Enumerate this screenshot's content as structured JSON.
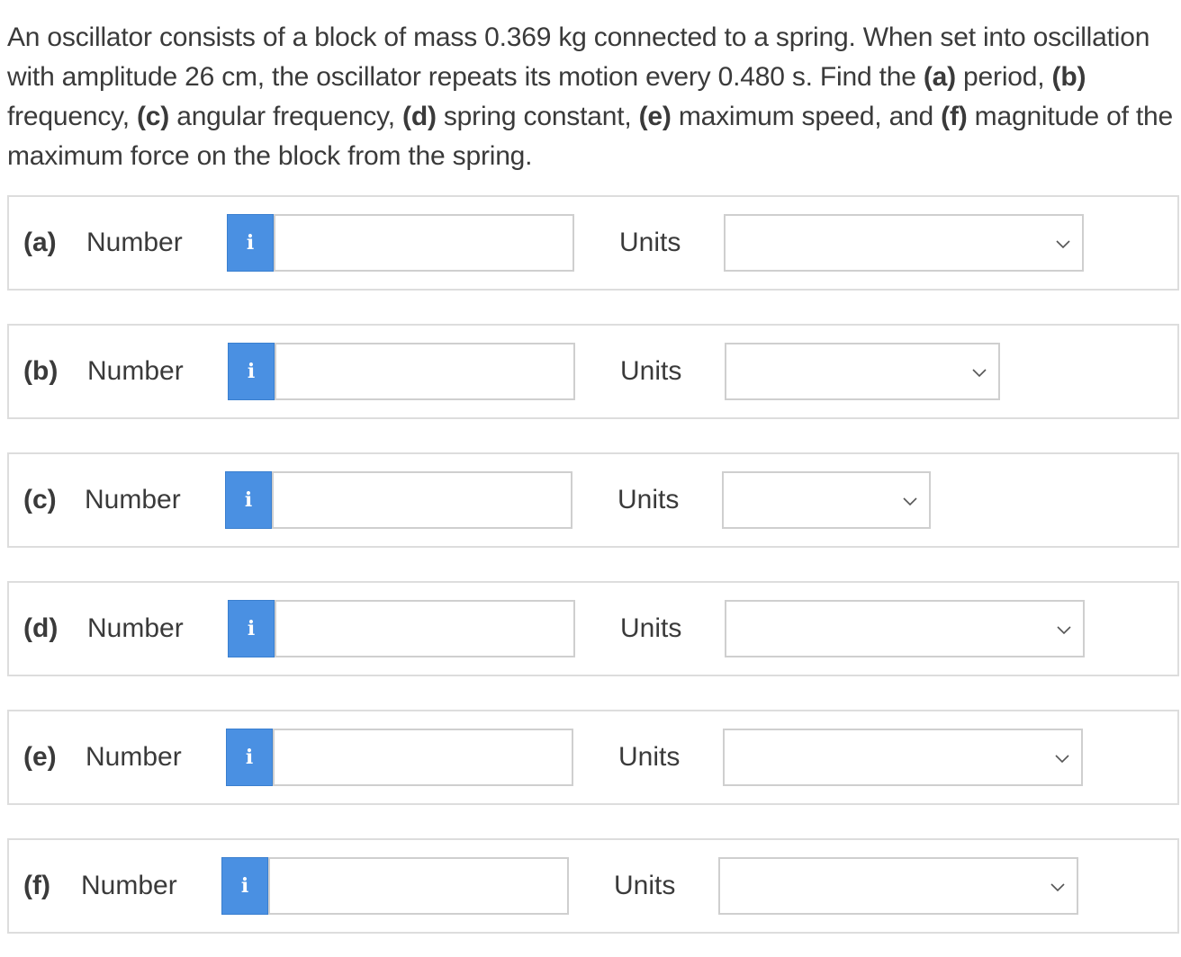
{
  "question": {
    "segments": [
      {
        "text": "An oscillator consists of a block of mass 0.369 kg connected to a spring. When set into oscillation with amplitude 26 cm, the oscillator repeats its motion every 0.480 s. Find the ",
        "bold": false
      },
      {
        "text": "(a)",
        "bold": true
      },
      {
        "text": " period, ",
        "bold": false
      },
      {
        "text": "(b)",
        "bold": true
      },
      {
        "text": " frequency, ",
        "bold": false
      },
      {
        "text": "(c)",
        "bold": true
      },
      {
        "text": " angular frequency, ",
        "bold": false
      },
      {
        "text": "(d)",
        "bold": true
      },
      {
        "text": " spring constant, ",
        "bold": false
      },
      {
        "text": "(e)",
        "bold": true
      },
      {
        "text": " maximum speed, and ",
        "bold": false
      },
      {
        "text": "(f)",
        "bold": true
      },
      {
        "text": " magnitude of the maximum force on the block from the spring.",
        "bold": false
      }
    ]
  },
  "parts": [
    {
      "label": "(a)",
      "number_label": "Number",
      "info_icon": "i",
      "value": "",
      "units_label": "Units",
      "units_value": ""
    },
    {
      "label": "(b)",
      "number_label": "Number",
      "info_icon": "i",
      "value": "",
      "units_label": "Units",
      "units_value": ""
    },
    {
      "label": "(c)",
      "number_label": "Number",
      "info_icon": "i",
      "value": "",
      "units_label": "Units",
      "units_value": ""
    },
    {
      "label": "(d)",
      "number_label": "Number",
      "info_icon": "i",
      "value": "",
      "units_label": "Units",
      "units_value": ""
    },
    {
      "label": "(e)",
      "number_label": "Number",
      "info_icon": "i",
      "value": "",
      "units_label": "Units",
      "units_value": ""
    },
    {
      "label": "(f)",
      "number_label": "Number",
      "info_icon": "i",
      "value": "",
      "units_label": "Units",
      "units_value": ""
    }
  ],
  "colors": {
    "info_button": "#4a90e2",
    "border": "#dddddd",
    "input_border": "#cfcfcf",
    "text": "#3a3a3a"
  }
}
